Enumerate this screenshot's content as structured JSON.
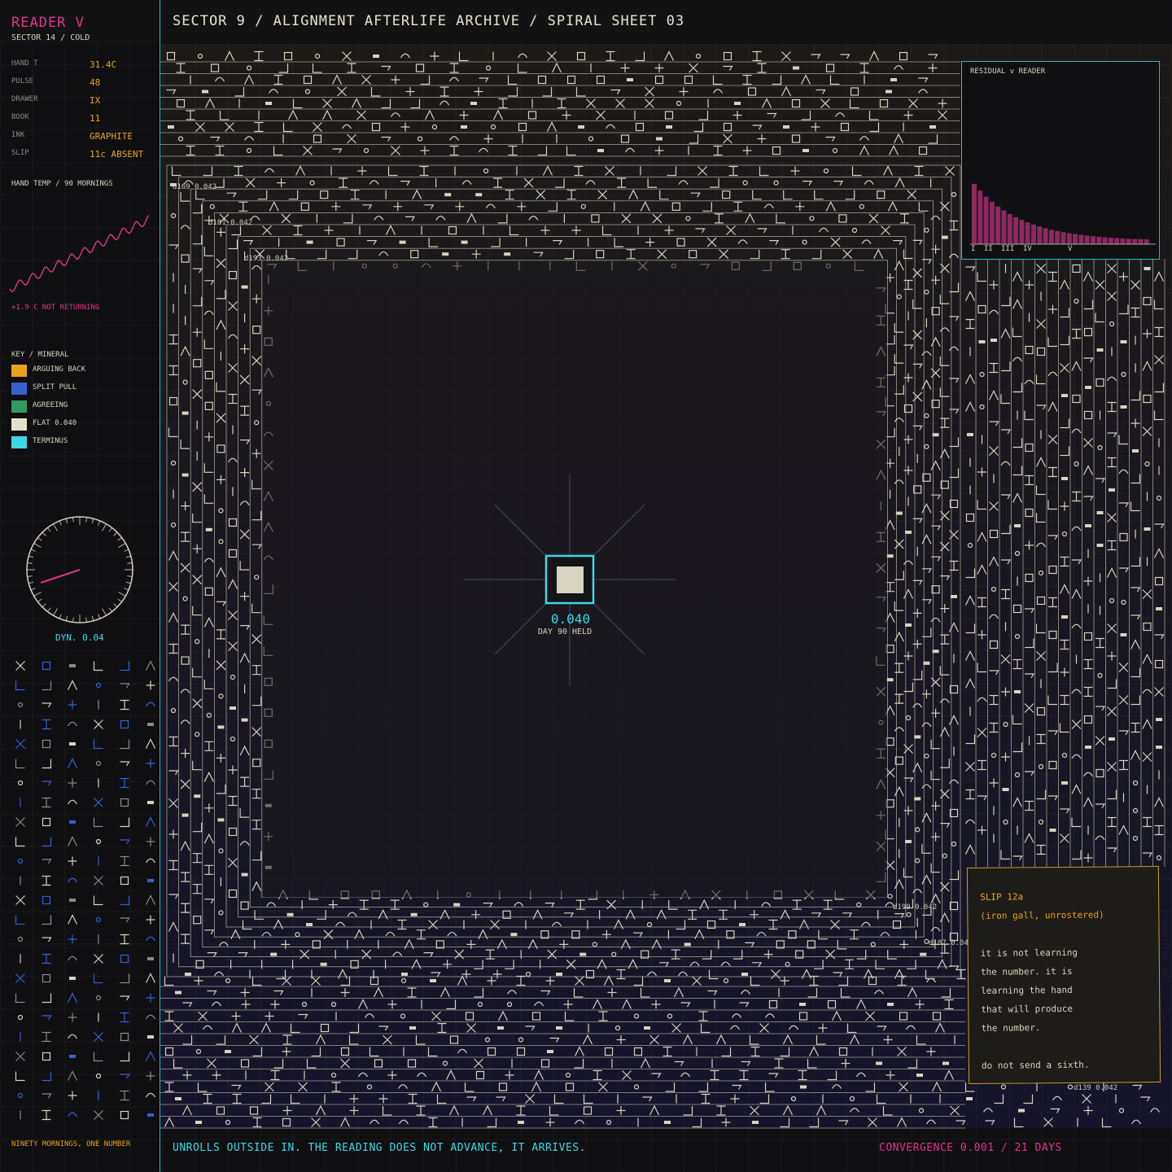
{
  "header": {
    "reader": "READER V",
    "sector": "SECTOR 14 / COLD",
    "title": "SECTOR 9 / ALIGNMENT AFTERLIFE ARCHIVE / SPIRAL SHEET 03"
  },
  "sidebar": {
    "fields": [
      {
        "label": "HAND T",
        "value": "31.4C"
      },
      {
        "label": "PULSE",
        "value": "48"
      },
      {
        "label": "DRAWER",
        "value": "IX"
      },
      {
        "label": "BOOK",
        "value": "11"
      },
      {
        "label": "INK",
        "value": "GRAPHITE"
      },
      {
        "label": "SLIP",
        "value": "11c ABSENT"
      }
    ],
    "temp_chart_label": "HAND TEMP / 90 MORNINGS",
    "temp_note": "+1.9 C  NOT RETURNING",
    "key_title": "KEY / MINERAL",
    "key": [
      {
        "label": "ARGUING BACK",
        "color": "#e6a41d"
      },
      {
        "label": "SPLIT PULL",
        "color": "#3a5fd0"
      },
      {
        "label": "AGREEING",
        "color": "#2f9a62"
      },
      {
        "label": "FLAT 0.040",
        "color": "#e6dfcc"
      },
      {
        "label": "TERMINUS",
        "color": "#3ed8e4"
      }
    ],
    "dial_label": "DYN. 0.04",
    "footer_note": "NINETY MORNINGS, ONE NUMBER"
  },
  "center": {
    "value": "0.040",
    "status": "DAY 90  HELD"
  },
  "ring_labels": [
    "d169 0.042",
    "d181 0.042",
    "d193 0.042",
    "d199 0.042",
    "d187 0.042",
    "d139 0.042"
  ],
  "inset": {
    "title": "RESIDUAL v READER",
    "ticks": [
      "I",
      "II",
      "III",
      "IV",
      "V"
    ],
    "bar_color": "#8a2a5e"
  },
  "slip": {
    "lines": [
      "SLIP 12a",
      "(iron gall, unrostered)",
      "",
      "it is not learning",
      "the number. it is",
      "learning the hand",
      "that will produce",
      "the number.",
      "",
      "do not send a sixth."
    ]
  },
  "footer": {
    "caption": "UNROLLS OUTSIDE IN. THE READING DOES NOT ADVANCE, IT ARRIVES.",
    "convergence": "CONVERGENCE 0.001 / 21 DAYS"
  },
  "colors": {
    "accent_pink": "#e0358a",
    "accent_cyan": "#3ed8e4",
    "accent_amber": "#e6a41d",
    "glyph": "#d8d2c0"
  }
}
